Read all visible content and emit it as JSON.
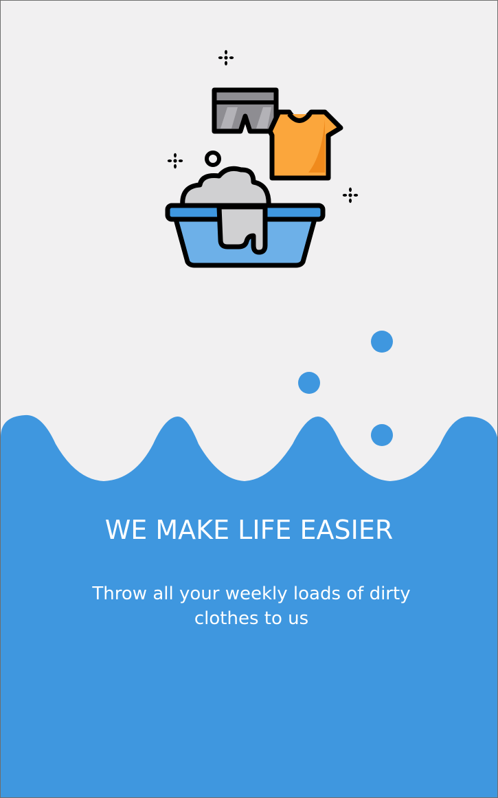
{
  "onboarding": {
    "title": "WE MAKE LIFE EASIER",
    "subtitle": "Throw all your weekly loads of dirty clothes to us"
  },
  "illustration": {
    "icon": "laundry-basin-icon",
    "items": [
      "shorts-icon",
      "tshirt-icon",
      "basin-icon",
      "sparkle-icon",
      "bubble-icon"
    ]
  },
  "colors": {
    "background": "#f1f0f1",
    "accent_blue": "#3f97df",
    "basin_blue": "#6db0e8",
    "shirt_orange": "#fba63c",
    "shorts_gray": "#8e8d92",
    "foam_gray": "#d0d0d2",
    "text": "#ffffff"
  }
}
